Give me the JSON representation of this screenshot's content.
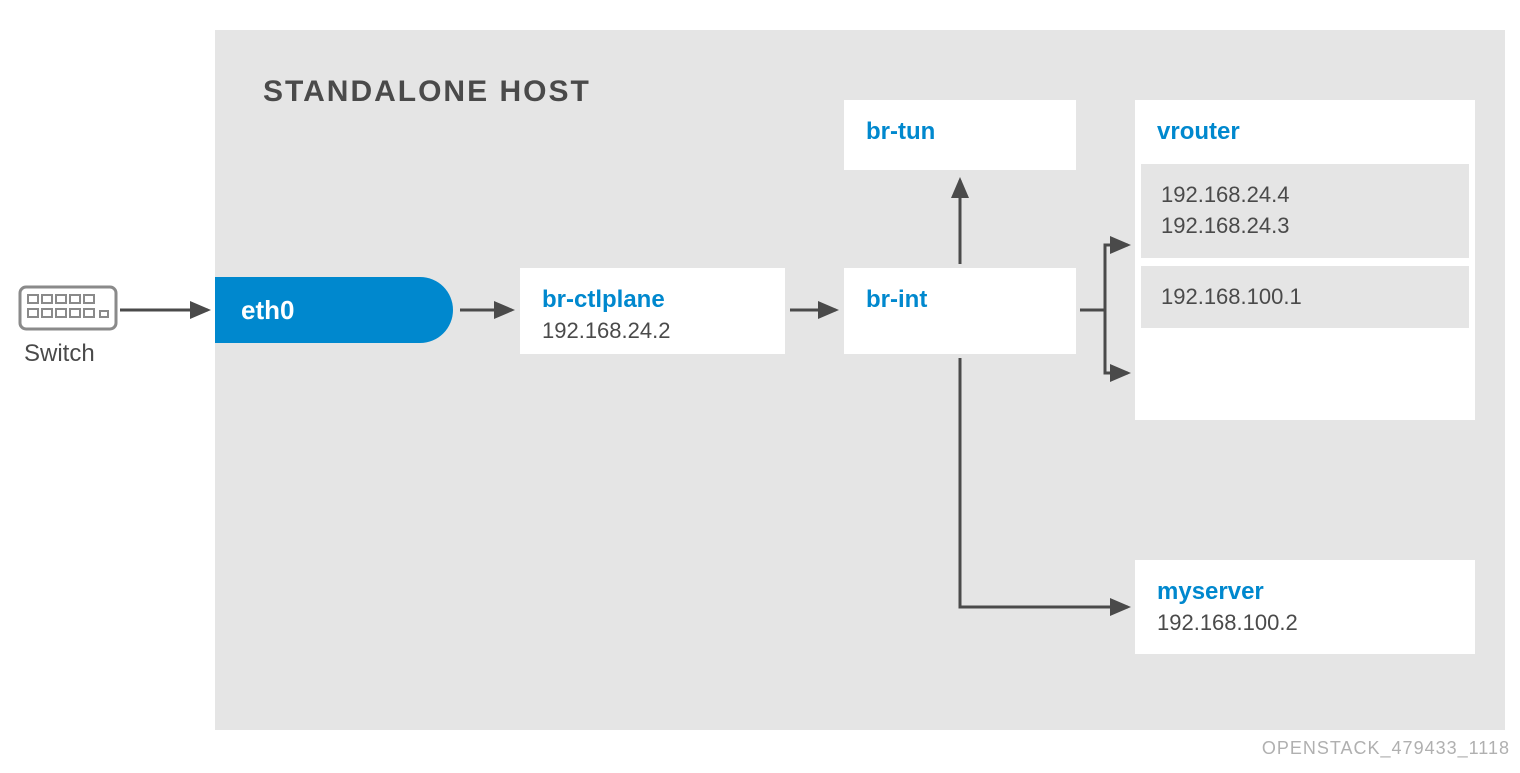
{
  "host": {
    "title": "STANDALONE HOST"
  },
  "switch": {
    "label": "Switch"
  },
  "eth0": {
    "label": "eth0"
  },
  "br_ctlplane": {
    "title": "br-ctlplane",
    "ip": "192.168.24.2"
  },
  "br_int": {
    "title": "br-int"
  },
  "br_tun": {
    "title": "br-tun"
  },
  "vrouter": {
    "title": "vrouter",
    "box1_ip1": "192.168.24.4",
    "box1_ip2": "192.168.24.3",
    "box2_ip": "192.168.100.1"
  },
  "myserver": {
    "title": "myserver",
    "ip": "192.168.100.2"
  },
  "footer": "OPENSTACK_479433_1118"
}
